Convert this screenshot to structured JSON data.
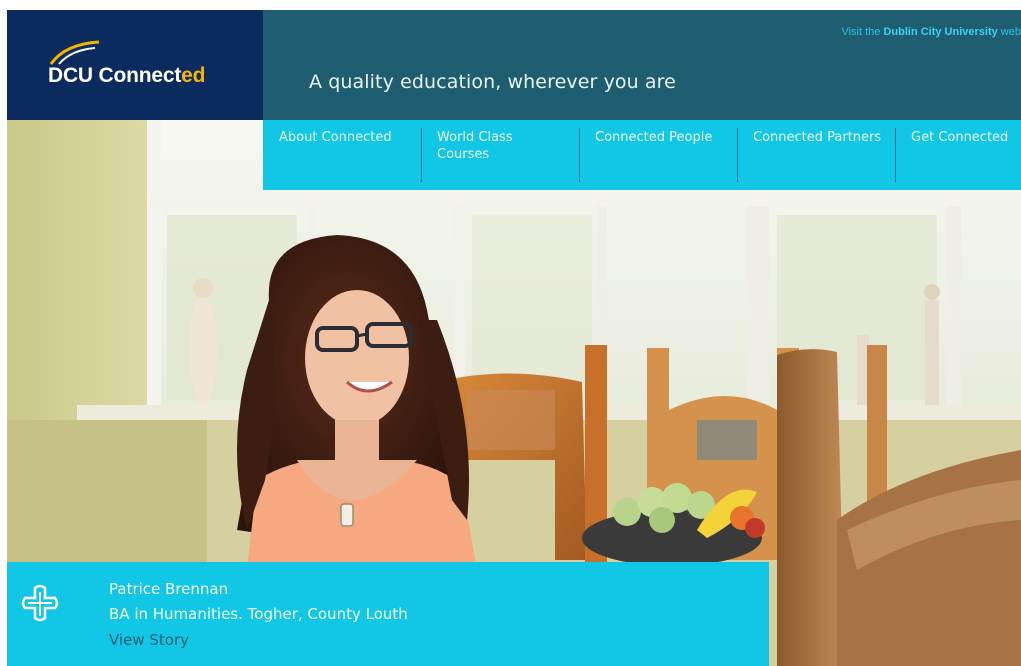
{
  "logo": {
    "prefix": "DCU ",
    "main": "Connect",
    "accent_part": "ed",
    "icon": "dcu-swoosh-icon",
    "accent_color": "#f5b400",
    "bg_color": "#0b2a5e"
  },
  "header": {
    "visit_prefix": "Visit the ",
    "visit_bold": "Dublin City University",
    "visit_suffix": " web",
    "tagline": "A quality education, wherever you are",
    "bg_color": "#1e5e70"
  },
  "nav": {
    "bg_color": "#12c6e6",
    "items": [
      {
        "label": "About Connected"
      },
      {
        "label": "World Class Courses"
      },
      {
        "label": "Connected People"
      },
      {
        "label": "Connected Partners"
      },
      {
        "label": "Get Connected"
      }
    ]
  },
  "caption": {
    "icon": "cross-plus-icon",
    "name": "Patrice Brennan",
    "course": "BA in Humanities. Togher, County Louth",
    "link": "View Story"
  }
}
